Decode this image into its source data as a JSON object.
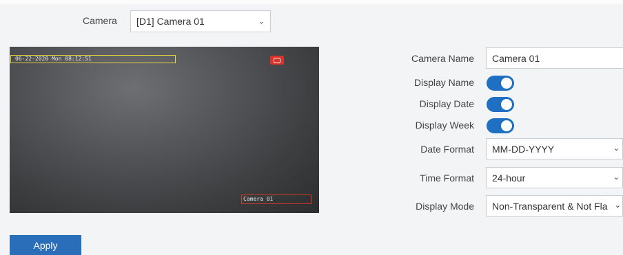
{
  "camera_selector": {
    "label": "Camera",
    "value": "[D1] Camera 01"
  },
  "preview": {
    "osd_datetime": "06-22-2020 Mon 08:12:51",
    "osd_camera_name": "Camera 01"
  },
  "form": {
    "camera_name": {
      "label": "Camera Name",
      "value": "Camera 01"
    },
    "display_name": {
      "label": "Display Name",
      "enabled": true
    },
    "display_date": {
      "label": "Display Date",
      "enabled": true
    },
    "display_week": {
      "label": "Display Week",
      "enabled": true
    },
    "date_format": {
      "label": "Date Format",
      "value": "MM-DD-YYYY"
    },
    "time_format": {
      "label": "Time Format",
      "value": "24-hour"
    },
    "display_mode": {
      "label": "Display Mode",
      "value": "Non-Transparent & Not Fla"
    }
  },
  "actions": {
    "apply_label": "Apply"
  },
  "colors": {
    "accent": "#1f6fc2",
    "button": "#2a6db8",
    "osd_date_box": "#e6d23a",
    "osd_name_box": "#d63a2a"
  }
}
